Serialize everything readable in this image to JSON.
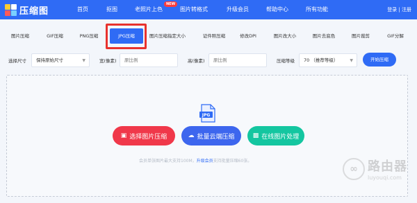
{
  "app": {
    "logo_text": "压缩图"
  },
  "nav": {
    "items": [
      "首页",
      "抠图",
      "老照片上色",
      "图片转格式",
      "升级会员",
      "帮助中心",
      "所有功能"
    ],
    "new_badge": "NEW",
    "auth": "登录 | 注册"
  },
  "tabs": {
    "items": [
      "图片压缩",
      "GIF压缩",
      "PNG压缩",
      "JPG压缩",
      "图片压缩指定大小",
      "证件照压缩",
      "修改DPI",
      "图片改大小",
      "图片去底色",
      "图片裁剪",
      "GIF分解"
    ],
    "active": "JPG压缩"
  },
  "options": {
    "size_label": "选择尺寸",
    "size_value": "保持原始尺寸",
    "width_label": "宽(像素)",
    "width_placeholder": "原比例",
    "height_label": "高(像素)",
    "height_placeholder": "原比例",
    "level_label": "压缩等级",
    "level_value": "70 （推荐等级）",
    "start_button": "开始压缩"
  },
  "upload": {
    "file_type_icon": "JPG",
    "select_button": "选择图片压缩",
    "batch_button": "批量云端压缩",
    "online_button": "在线图片处理",
    "hint_prefix": "会员单张图片最大支持100M，",
    "hint_link": "升级会员",
    "hint_suffix": "支持批量压缩60张。"
  },
  "watermark": {
    "title": "路由器",
    "subtitle": "luyouqi.com"
  },
  "colors": {
    "brand": "#2f6bf5",
    "red": "#f0384a",
    "blue": "#3d66ee",
    "green": "#14c6a0",
    "highlight": "#e8322d"
  }
}
